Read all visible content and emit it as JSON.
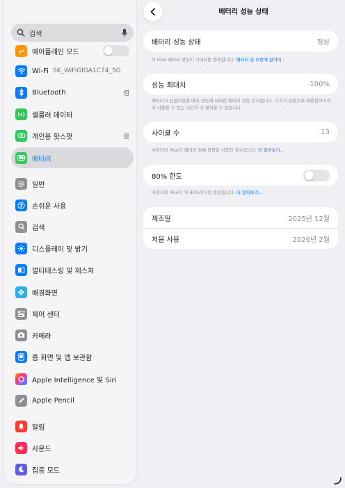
{
  "sidebar": {
    "search_label": "검색",
    "items": [
      {
        "label": "에어플레인 모드",
        "icon": "airplane-icon",
        "color": "#ff9500"
      },
      {
        "label": "Wi-Fi",
        "ssid": "SK_WiFiGIGA1C74_5G",
        "icon": "wifi-icon",
        "color": "#0a7aff"
      },
      {
        "label": "Bluetooth",
        "value": "켬",
        "icon": "bluetooth-icon",
        "color": "#0a7aff"
      },
      {
        "label": "셀룰러 데이터",
        "icon": "cellular-icon",
        "color": "#34c759"
      },
      {
        "label": "개인용 핫스팟",
        "value": "끔",
        "icon": "hotspot-icon",
        "color": "#34c759"
      },
      {
        "label": "배터리",
        "icon": "battery-icon",
        "color": "#34c759"
      },
      {
        "label": "일반",
        "icon": "gear-icon",
        "color": "#8e8e93"
      },
      {
        "label": "손쉬운 사용",
        "icon": "accessibility-icon",
        "color": "#0a7aff"
      },
      {
        "label": "검색",
        "icon": "search-icon",
        "color": "#8e8e93"
      },
      {
        "label": "디스플레이 및 밝기",
        "icon": "display-icon",
        "color": "#0a7aff"
      },
      {
        "label": "멀티태스킹 및 제스처",
        "icon": "multitasking-icon",
        "color": "#0a7aff"
      },
      {
        "label": "배경화면",
        "icon": "wallpaper-icon",
        "color": "#32ade6"
      },
      {
        "label": "제어 센터",
        "icon": "control-center-icon",
        "color": "#8e8e93"
      },
      {
        "label": "카메라",
        "icon": "camera-icon",
        "color": "#8e8e93"
      },
      {
        "label": "홈 화면 및 앱 보관함",
        "icon": "home-screen-icon",
        "color": "#0a7aff"
      },
      {
        "label": "Apple Intelligence 및 Siri",
        "icon": "siri-icon",
        "color": "#a15df0"
      },
      {
        "label": "Apple Pencil",
        "icon": "pencil-icon",
        "color": "#8e8e93"
      },
      {
        "label": "알림",
        "icon": "bell-icon",
        "color": "#ff3b30"
      },
      {
        "label": "사운드",
        "icon": "speaker-icon",
        "color": "#ff2d55"
      },
      {
        "label": "집중 모드",
        "icon": "moon-icon",
        "color": "#5e5ce6"
      }
    ]
  },
  "main": {
    "title": "배터리 성능 상태",
    "health": {
      "label": "배터리 성능 상태",
      "value": "정상"
    },
    "health_note": "이 iPad 배터리 성능이 기대치를 충족합니다.",
    "health_link": "배터리 및 보증에 관하여...",
    "max_capacity": {
      "label": "성능 최대치",
      "value": "100%"
    },
    "capacity_note": "배터리가 신품이었을 때의 성능에 대비한 배터리 성능 수치입니다. 수치가 낮을수록 재충전하기까지 사용할 수 있는 시간이 더 줄어들 수 있습니다.",
    "cycle": {
      "label": "사이클 수",
      "value": "13"
    },
    "cycle_note": "사용자의 iPad가 배터리 전체 용량을 사용한 횟수입니다.",
    "cycle_link": "더 알아보기...",
    "limit": {
      "label": "80% 한도",
      "on": false
    },
    "limit_note": "사용자의 iPad가 약 80%까지만 충전됩니다.",
    "limit_link": "더 알아보기...",
    "manufacture": {
      "label": "제조일",
      "value": "2025년 12월"
    },
    "first_use": {
      "label": "처음 사용",
      "value": "2026년 2월"
    }
  }
}
